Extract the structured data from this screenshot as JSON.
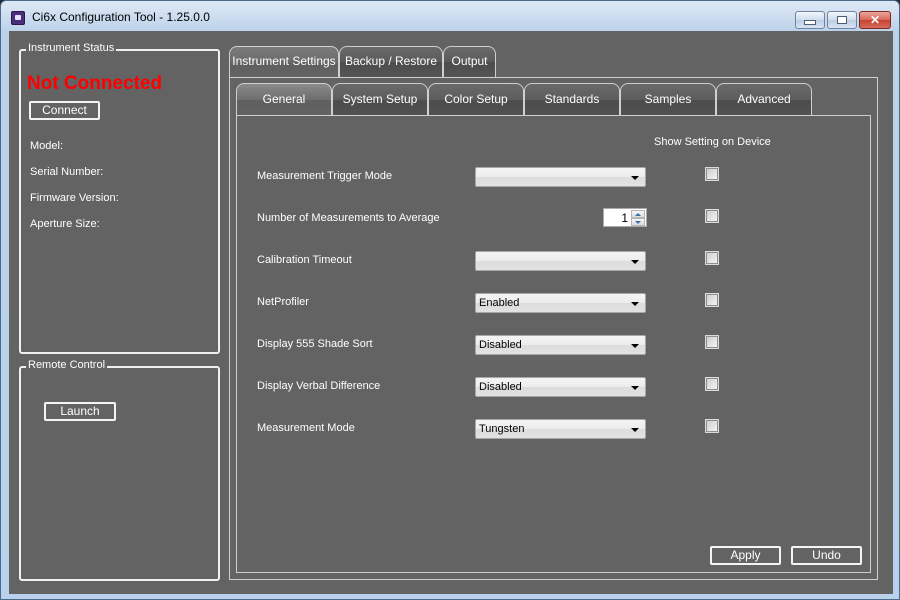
{
  "window": {
    "title": "Ci6x Configuration Tool - 1.25.0.0",
    "controls": {
      "minimize": "minimize",
      "maximize": "maximize",
      "close": "close"
    }
  },
  "instrument_status": {
    "group_title": "Instrument Status",
    "status_text": "Not Connected",
    "status_color": "#ff0000",
    "connect_label": "Connect",
    "fields": [
      {
        "label": "Model:"
      },
      {
        "label": "Serial Number:"
      },
      {
        "label": "Firmware Version:"
      },
      {
        "label": "Aperture Size:"
      }
    ]
  },
  "remote_control": {
    "group_title": "Remote Control",
    "launch_label": "Launch"
  },
  "main_tabs": [
    {
      "label": "Instrument Settings",
      "active": true
    },
    {
      "label": "Backup / Restore",
      "active": false
    },
    {
      "label": "Output",
      "active": false
    }
  ],
  "sub_tabs": [
    {
      "label": "General",
      "active": true
    },
    {
      "label": "System Setup",
      "active": false
    },
    {
      "label": "Color Setup",
      "active": false
    },
    {
      "label": "Standards",
      "active": false
    },
    {
      "label": "Samples",
      "active": false
    },
    {
      "label": "Advanced",
      "active": false
    }
  ],
  "general": {
    "column_header": "Show Setting on Device",
    "settings": [
      {
        "label": "Measurement Trigger Mode",
        "control": "combo",
        "value": "",
        "show_on_device": false
      },
      {
        "label": "Number of Measurements to Average",
        "control": "spinner",
        "value": "1",
        "show_on_device": false
      },
      {
        "label": "Calibration Timeout",
        "control": "combo",
        "value": "",
        "show_on_device": false
      },
      {
        "label": "NetProfiler",
        "control": "combo",
        "value": "Enabled",
        "show_on_device": false
      },
      {
        "label": "Display 555 Shade Sort",
        "control": "combo",
        "value": "Disabled",
        "show_on_device": false
      },
      {
        "label": "Display Verbal Difference",
        "control": "combo",
        "value": "Disabled",
        "show_on_device": false
      },
      {
        "label": "Measurement Mode",
        "control": "combo",
        "value": "Tungsten",
        "show_on_device": false
      }
    ],
    "apply_label": "Apply",
    "undo_label": "Undo"
  }
}
